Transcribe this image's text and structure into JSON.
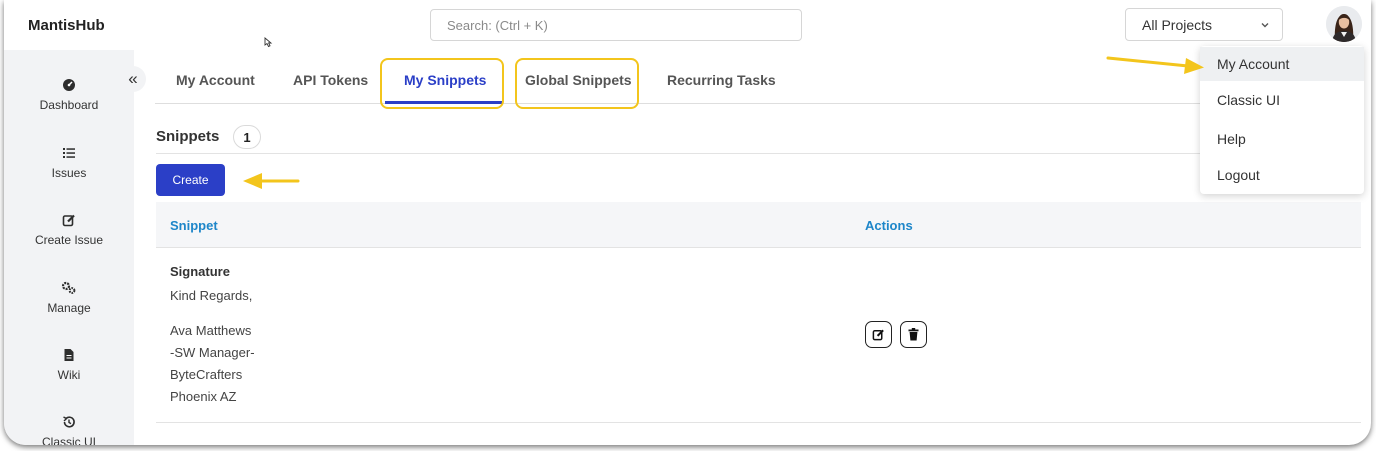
{
  "app": {
    "brand": "MantisHub"
  },
  "search": {
    "placeholder": "Search: (Ctrl + K)"
  },
  "project_select": {
    "value": "All Projects"
  },
  "sidebar": {
    "collapse_glyph": "«",
    "items": [
      {
        "label": "Dashboard",
        "icon": "dashboard-icon"
      },
      {
        "label": "Issues",
        "icon": "list-icon"
      },
      {
        "label": "Create Issue",
        "icon": "edit-icon"
      },
      {
        "label": "Manage",
        "icon": "gears-icon"
      },
      {
        "label": "Wiki",
        "icon": "file-icon"
      },
      {
        "label": "Classic UI",
        "icon": "history-icon"
      }
    ]
  },
  "tabs": [
    {
      "label": "My Account",
      "active": false
    },
    {
      "label": "API Tokens",
      "active": false
    },
    {
      "label": "My Snippets",
      "active": true
    },
    {
      "label": "Global Snippets",
      "active": false
    },
    {
      "label": "Recurring Tasks",
      "active": false
    }
  ],
  "snippets": {
    "title": "Snippets",
    "count": "1",
    "create_label": "Create",
    "columns": {
      "snippet": "Snippet",
      "actions": "Actions"
    },
    "rows": [
      {
        "name": "Signature",
        "lines": [
          "Kind Regards,",
          "Ava Matthews",
          "-SW Manager-",
          "ByteCrafters",
          "Phoenix AZ"
        ]
      }
    ]
  },
  "user_menu": {
    "items": [
      {
        "label": "My Account"
      },
      {
        "label": "Classic UI"
      },
      {
        "label": "Help"
      },
      {
        "label": "Logout"
      }
    ]
  },
  "colors": {
    "accent": "#2b3fc7",
    "header_link": "#1d86c9",
    "annotation": "#f3c51c"
  }
}
